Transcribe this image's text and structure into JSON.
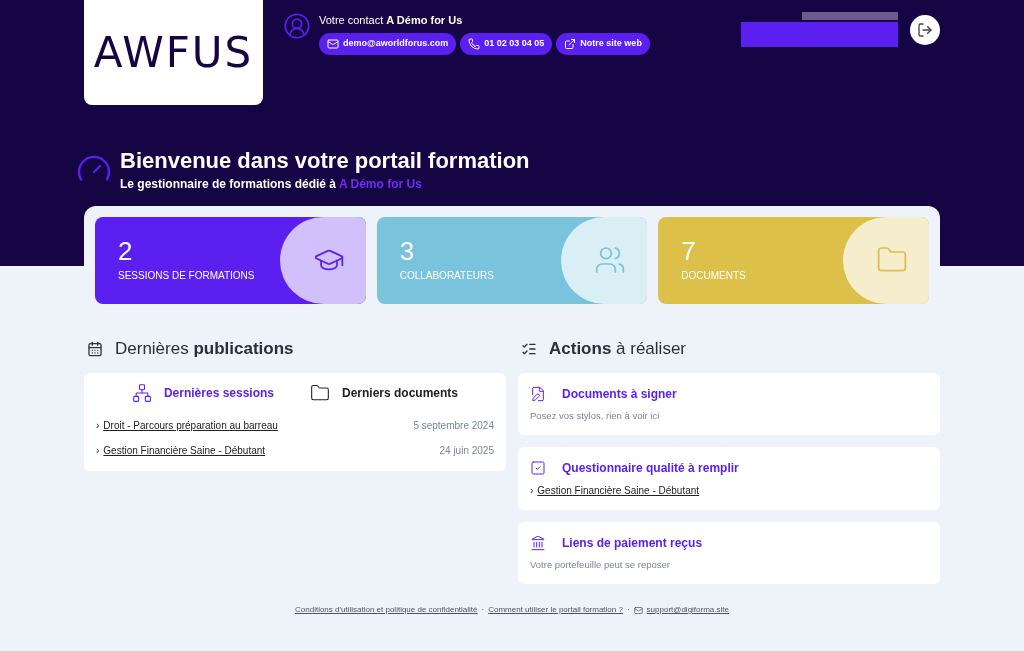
{
  "logo": {
    "text": "AWFUS"
  },
  "contact": {
    "label": "Votre contact",
    "name": "A Démo for Us",
    "buttons": [
      {
        "kind": "email",
        "label": "demo@aworldforus.com"
      },
      {
        "kind": "phone",
        "label": "01 02 03 04 05"
      },
      {
        "kind": "web",
        "label": "Notre site web"
      }
    ]
  },
  "welcome": {
    "title": "Bienvenue dans votre portail formation",
    "subtitle": "Le gestionnaire de formations dédié à",
    "organization": "A Démo for Us"
  },
  "stats": [
    {
      "kind": "sessions",
      "value": "2",
      "label": "SESSIONS DE FORMATIONS",
      "color": "#5b1ff0"
    },
    {
      "kind": "people",
      "value": "3",
      "label": "COLLABORATEURS",
      "color": "#7ac3dc"
    },
    {
      "kind": "documents",
      "value": "7",
      "label": "DOCUMENTS",
      "color": "#dcc04a"
    }
  ],
  "publications": {
    "title_light": "Dernières",
    "title_bold": "publications",
    "tabs": [
      {
        "kind": "sessions",
        "label": "Dernières sessions",
        "selected": true
      },
      {
        "kind": "documents",
        "label": "Derniers documents",
        "selected": false
      }
    ],
    "rows": [
      {
        "marker": "›",
        "title": "Droit - Parcours préparation au barreau",
        "date": "5 septembre 2024"
      },
      {
        "marker": "›",
        "title": "Gestion Financière Saine - Débutant",
        "date": "24 juin 2025"
      }
    ]
  },
  "actions": {
    "title_bold": "Actions",
    "title_light": "à réaliser",
    "cards": [
      {
        "kind": "sign",
        "title": "Documents à signer",
        "note": "Posez vos stylos, rien à voir ici"
      },
      {
        "kind": "survey",
        "title": "Questionnaire qualité à remplir",
        "links": [
          {
            "marker": "›",
            "title": "Gestion Financière Saine - Débutant"
          }
        ]
      },
      {
        "kind": "payment",
        "title": "Liens de paiement reçus",
        "note": "Votre portefeuille peut se reposer"
      }
    ]
  },
  "footer": {
    "links": [
      {
        "kind": "link",
        "label": "Conditions d'utilisation et politique de confidentialité"
      },
      {
        "kind": "link",
        "separator": "·",
        "label": "Comment utiliser le portail formation ?"
      },
      {
        "kind": "email",
        "separator": "·",
        "label": "support@digiforma.site"
      }
    ]
  }
}
